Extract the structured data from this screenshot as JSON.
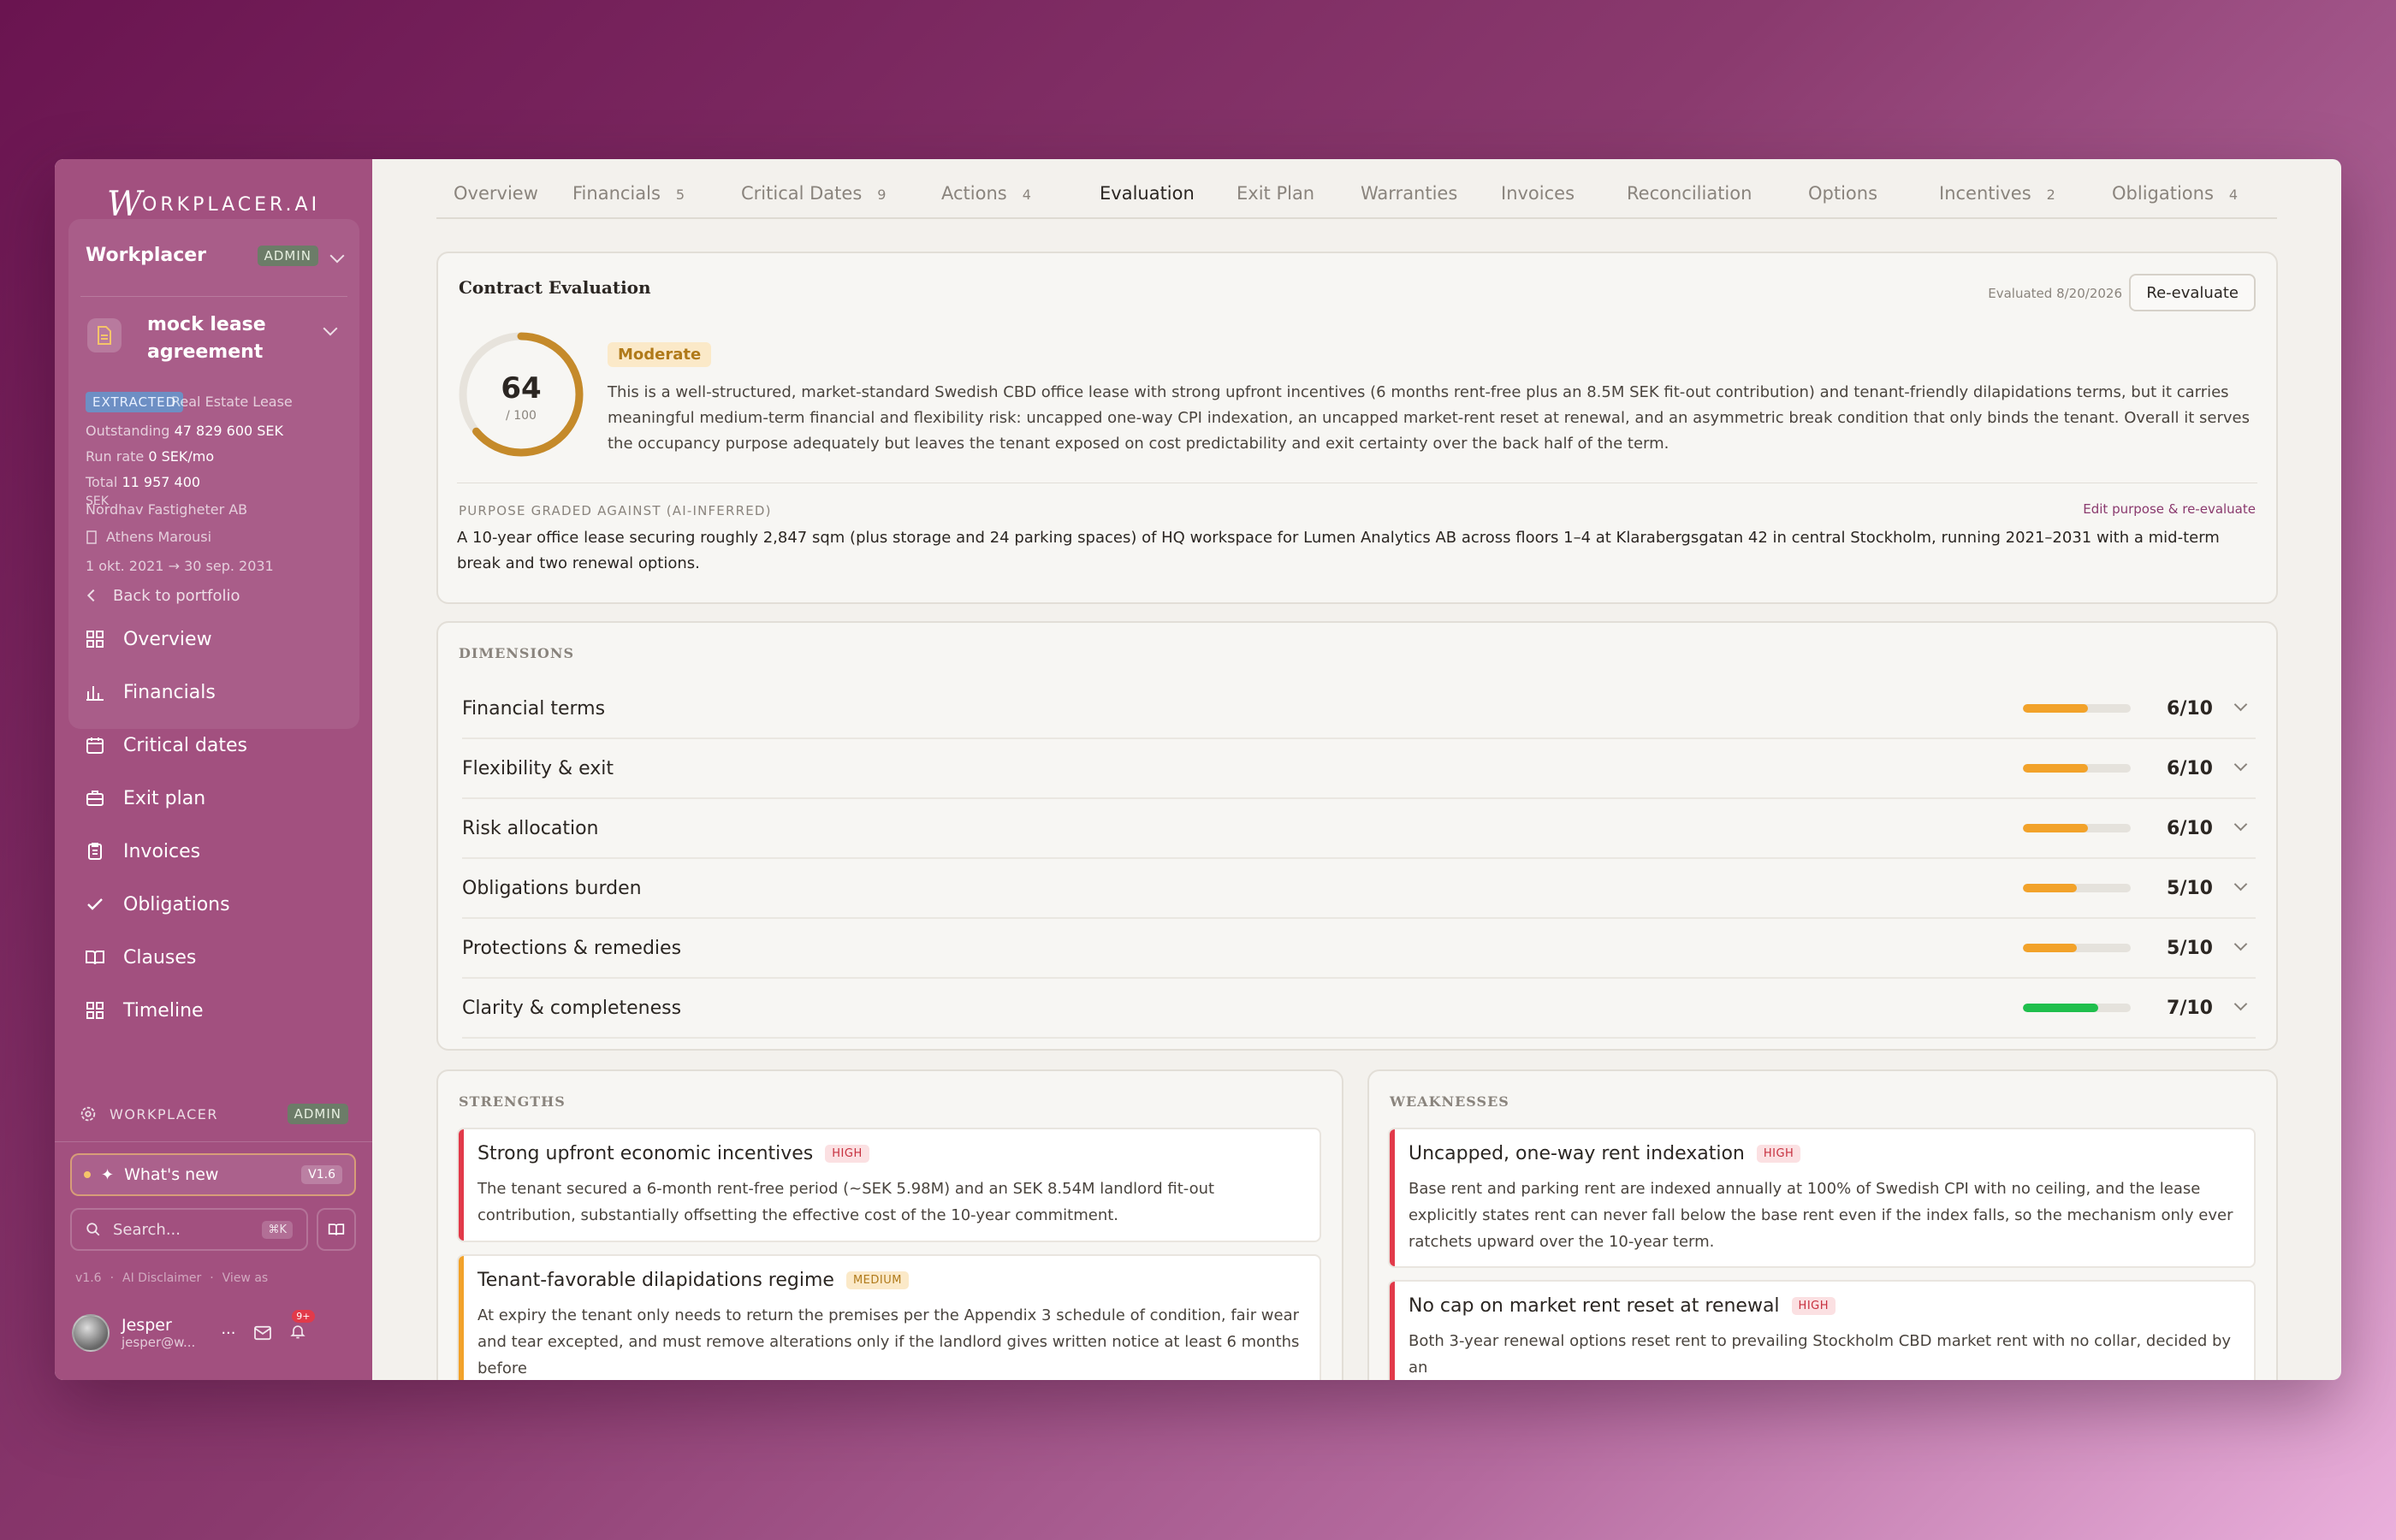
{
  "app": {
    "logo_text": "ORKPLACER.AI",
    "logo_letter": "W"
  },
  "org": {
    "name": "Workplacer",
    "role_badge": "ADMIN"
  },
  "contract": {
    "name": "mock lease agreement",
    "status_tag": "EXTRACTED",
    "type": "Real Estate Lease",
    "outstanding_label": "Outstanding",
    "outstanding_value": "47 829 600 SEK",
    "run_rate_label": "Run rate",
    "run_rate_value": "0 SEK/mo",
    "total_label": "Total",
    "total_value": "11 957 400",
    "currency_overlap": "SEK",
    "landlord": "Nordhav Fastigheter AB",
    "tenant": "Athens Marousi",
    "period": "1 okt. 2021 → 30 sep. 2031"
  },
  "nav": {
    "back": "Back to portfolio",
    "items": [
      {
        "label": "Overview",
        "icon": "grid-icon"
      },
      {
        "label": "Financials",
        "icon": "bar-chart-icon"
      },
      {
        "label": "Critical dates",
        "icon": "calendar-icon"
      },
      {
        "label": "Exit plan",
        "icon": "briefcase-icon"
      },
      {
        "label": "Invoices",
        "icon": "clipboard-icon"
      },
      {
        "label": "Obligations",
        "icon": "check-icon"
      },
      {
        "label": "Clauses",
        "icon": "book-icon"
      },
      {
        "label": "Timeline",
        "icon": "grid-icon"
      }
    ]
  },
  "workspace": {
    "label": "WORKPLACER",
    "badge": "ADMIN"
  },
  "whats_new": {
    "label": "What's new",
    "version": "V1.6"
  },
  "search": {
    "placeholder": "Search...",
    "shortcut": "⌘K"
  },
  "footer_links": {
    "version": "v1.6",
    "disclaimer": "AI Disclaimer",
    "view_as": "View as",
    "sep": "·"
  },
  "user": {
    "name": "Jesper",
    "email": "jesper@w...",
    "notifications": "9+",
    "more": "···"
  },
  "tabs": [
    {
      "label": "Overview",
      "count": ""
    },
    {
      "label": "Financials",
      "count": "5"
    },
    {
      "label": "Critical Dates",
      "count": "9"
    },
    {
      "label": "Actions",
      "count": "4"
    },
    {
      "label": "Evaluation",
      "count": ""
    },
    {
      "label": "Exit Plan",
      "count": ""
    },
    {
      "label": "Warranties",
      "count": ""
    },
    {
      "label": "Invoices",
      "count": ""
    },
    {
      "label": "Reconciliation",
      "count": ""
    },
    {
      "label": "Options",
      "count": ""
    },
    {
      "label": "Incentives",
      "count": "2"
    },
    {
      "label": "Obligations",
      "count": "4"
    }
  ],
  "active_tab": "Evaluation",
  "evaluation": {
    "title": "Contract Evaluation",
    "evaluated": "Evaluated 8/20/2026",
    "reevaluate": "Re-evaluate",
    "score": 64,
    "score_max": "/ 100",
    "rating": "Moderate",
    "summary": "This is a well-structured, market-standard Swedish CBD office lease with strong upfront incentives (6 months rent-free plus an 8.5M SEK fit-out contribution) and tenant-friendly dilapidations terms, but it carries meaningful medium-term financial and flexibility risk: uncapped one-way CPI indexation, an uncapped market-rent reset at renewal, and an asymmetric break condition that only binds the tenant. Overall it serves the occupancy purpose adequately but leaves the tenant exposed on cost predictability and exit certainty over the back half of the term.",
    "purpose_label": "PURPOSE GRADED AGAINST (AI-INFERRED)",
    "purpose_edit": "Edit purpose & re-evaluate",
    "purpose": "A 10-year office lease securing roughly 2,847 sqm (plus storage and 24 parking spaces) of HQ workspace for Lumen Analytics AB across floors 1–4 at Klarabergsgatan 42 in central Stockholm, running 2021–2031 with a mid-term break and two renewal options."
  },
  "dimensions": {
    "label": "DIMENSIONS",
    "items": [
      {
        "name": "Financial terms",
        "score": 6,
        "display": "6/10"
      },
      {
        "name": "Flexibility & exit",
        "score": 6,
        "display": "6/10"
      },
      {
        "name": "Risk allocation",
        "score": 6,
        "display": "6/10"
      },
      {
        "name": "Obligations burden",
        "score": 5,
        "display": "5/10"
      },
      {
        "name": "Protections & remedies",
        "score": 5,
        "display": "5/10"
      },
      {
        "name": "Clarity & completeness",
        "score": 7,
        "display": "7/10"
      }
    ]
  },
  "strengths": {
    "label": "STRENGTHS",
    "items": [
      {
        "title": "Strong upfront economic incentives",
        "severity": "HIGH",
        "body": "The tenant secured a 6-month rent-free period (~SEK 5.98M) and an SEK 8.54M landlord fit-out contribution, substantially offsetting the effective cost of the 10-year commitment."
      },
      {
        "title": "Tenant-favorable dilapidations regime",
        "severity": "MEDIUM",
        "body": "At expiry the tenant only needs to return the premises per the Appendix 3 schedule of condition, fair wear and tear excepted, and must remove alterations only if the landlord gives written notice at least 6 months before"
      }
    ]
  },
  "weaknesses": {
    "label": "WEAKNESSES",
    "items": [
      {
        "title": "Uncapped, one-way rent indexation",
        "severity": "HIGH",
        "body": "Base rent and parking rent are indexed annually at 100% of Swedish CPI with no ceiling, and the lease explicitly states rent can never fall below the base rent even if the index falls, so the mechanism only ever ratchets upward over the 10-year term."
      },
      {
        "title": "No cap on market rent reset at renewal",
        "severity": "HIGH",
        "body": "Both 3-year renewal options reset rent to prevailing Stockholm CBD market rent with no collar, decided by an"
      }
    ]
  },
  "colors": {
    "accent": "#a2507f",
    "gauge": "#c58a2a",
    "bar_orange": "#f2a22a",
    "bar_green": "#1fbf4c",
    "high": "#e23a4a"
  }
}
